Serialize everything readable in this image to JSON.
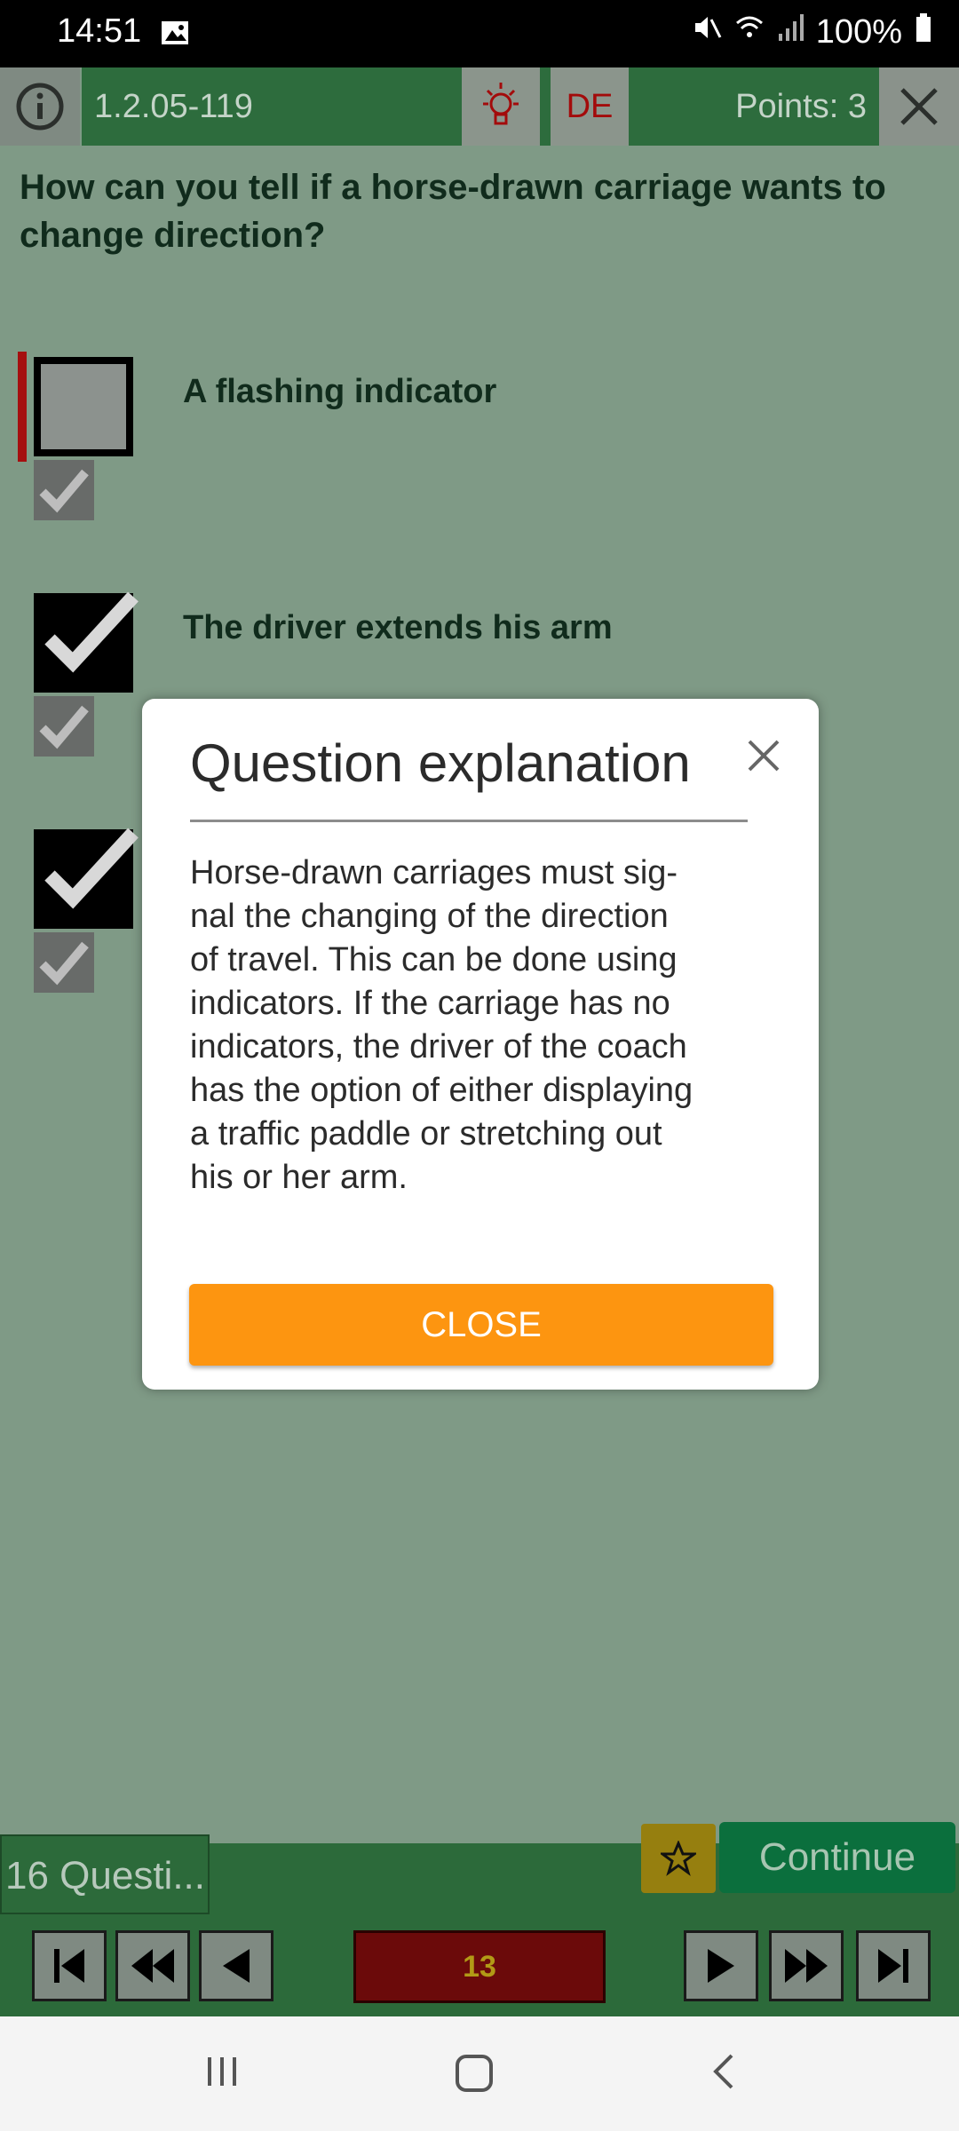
{
  "status_bar": {
    "time": "14:51",
    "battery": "100%"
  },
  "header": {
    "question_id": "1.2.05-119",
    "language": "DE",
    "points": "Points: 3"
  },
  "question": {
    "text": "How can you tell if a horse-drawn carriage wants to change direction?"
  },
  "answers": [
    {
      "label": "A flashing indicator",
      "checked": false
    },
    {
      "label": "The driver extends his arm",
      "checked": true
    },
    {
      "label": "",
      "checked": true
    }
  ],
  "footer": {
    "question_count": "16 Questi...",
    "continue_label": "Continue",
    "current_page": "13"
  },
  "dialog": {
    "title": "Question explanation",
    "body_lines": [
      "Horse-drawn carriages must sig-",
      "nal the changing of the direction",
      "of travel. This can be done using",
      "indicators. If the carriage has no",
      "indicators, the driver of the coach",
      "has the option of either displaying",
      "a traffic paddle or stretching out",
      "his or her arm."
    ],
    "close_label": "CLOSE"
  },
  "colors": {
    "accent_orange": "#fd9510",
    "header_green": "#2d6c3d",
    "error_red": "#a50f0f"
  }
}
